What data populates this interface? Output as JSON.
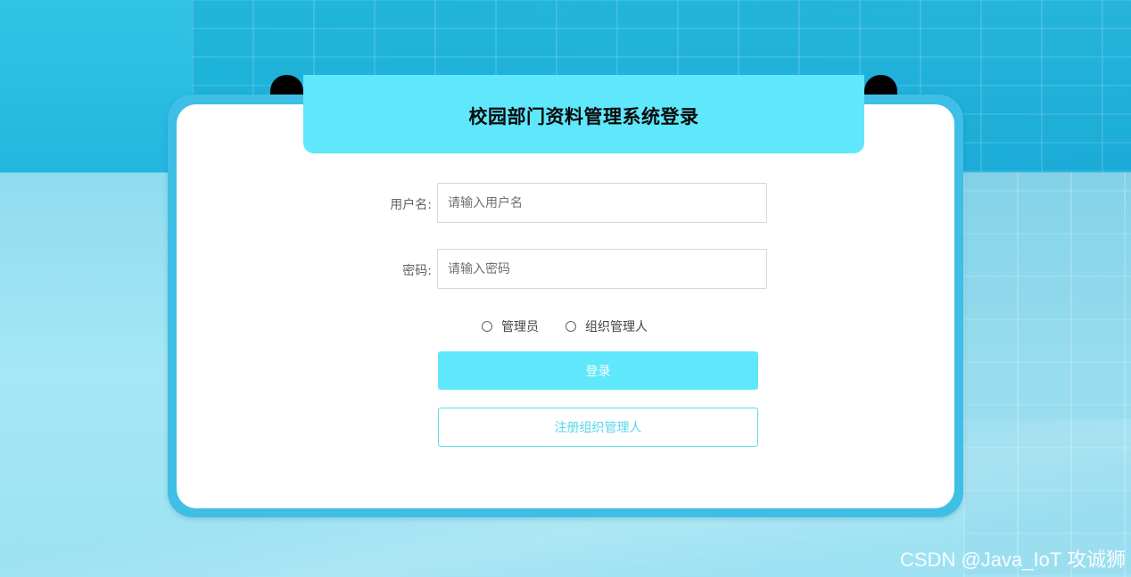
{
  "page": {
    "title": "校园部门资料管理系统登录"
  },
  "form": {
    "username_label": "用户名:",
    "username_placeholder": "请输入用户名",
    "password_label": "密码:",
    "password_placeholder": "请输入密码",
    "roles": [
      {
        "label": "管理员",
        "checked": false
      },
      {
        "label": "组织管理人",
        "checked": false
      }
    ],
    "login_label": "登录",
    "register_label": "注册组织管理人"
  },
  "watermark": "CSDN @Java_IoT 攻诚狮",
  "colors": {
    "accent": "#5fe7fb",
    "card_border": "#3fbfe6",
    "background": "#22b7df"
  }
}
